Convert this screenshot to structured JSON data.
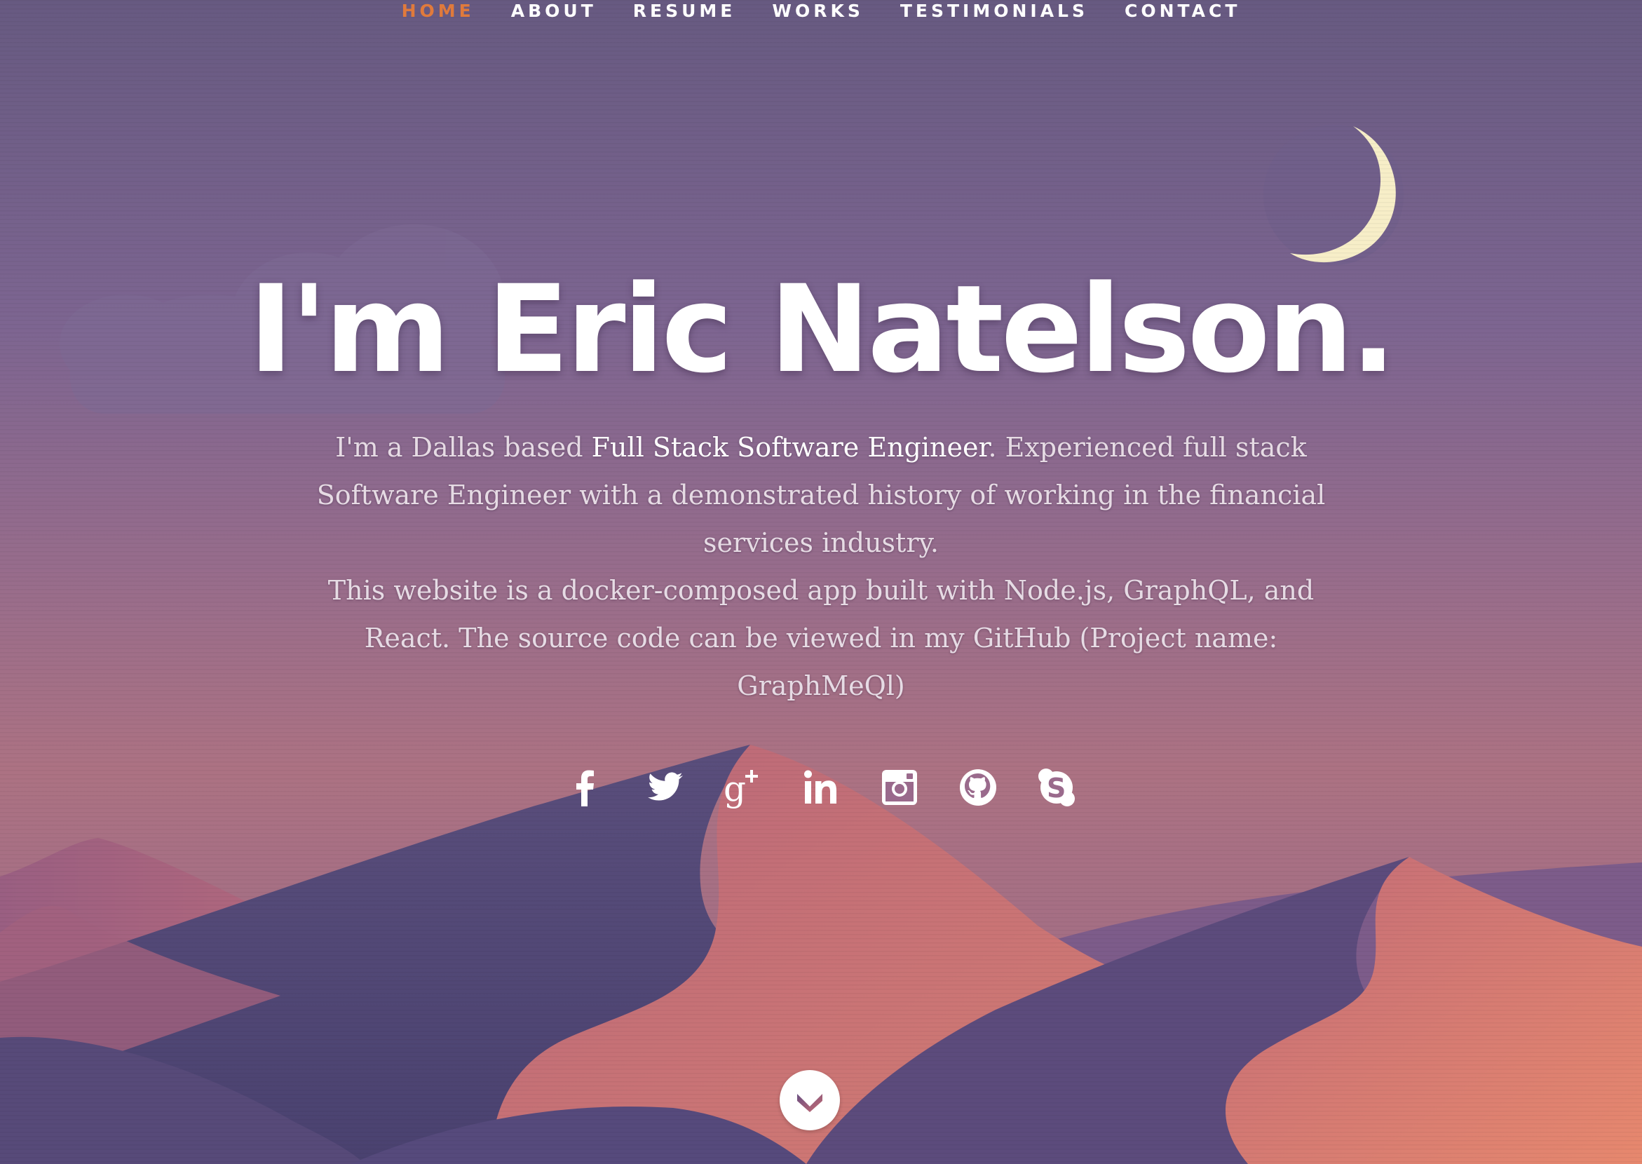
{
  "nav": {
    "items": [
      {
        "label": "HOME",
        "active": true
      },
      {
        "label": "ABOUT",
        "active": false
      },
      {
        "label": "RESUME",
        "active": false
      },
      {
        "label": "WORKS",
        "active": false
      },
      {
        "label": "TESTIMONIALS",
        "active": false
      },
      {
        "label": "CONTACT",
        "active": false
      }
    ],
    "active_color": "#e07a3c"
  },
  "hero": {
    "headline": "I'm Eric Natelson.",
    "intro_pre": "I'm a Dallas based ",
    "intro_highlight": "Full Stack Software Engineer",
    "intro_post": ". Experienced full stack Software Engineer with a demonstrated history of working in the financial services industry.",
    "intro_line2": "This website is a docker-composed app built with Node.js, GraphQL, and React. The source code can be viewed in my GitHub (Project name: GraphMeQl)"
  },
  "social": {
    "icons": [
      "facebook-icon",
      "twitter-icon",
      "google-plus-icon",
      "linkedin-icon",
      "instagram-icon",
      "github-icon",
      "skype-icon"
    ]
  },
  "scroll": {
    "icon": "chevron-down-icon"
  },
  "colors": {
    "sky_top": "#675a81",
    "sky_bottom": "#ac7283",
    "dune_dark": "#4e4674",
    "dune_light": "#c2707a",
    "moon": "#f7eec8"
  }
}
